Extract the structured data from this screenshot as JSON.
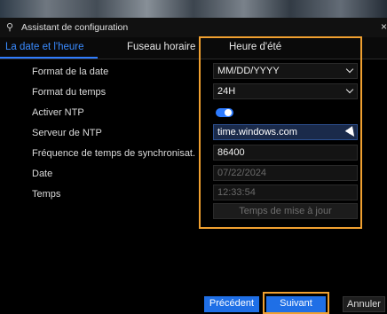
{
  "window": {
    "title": "Assistant de configuration",
    "close_glyph": "×"
  },
  "tabs": [
    {
      "label": "La date et l'heure",
      "active": true
    },
    {
      "label": "Fuseau horaire",
      "active": false
    },
    {
      "label": "Heure d'été",
      "active": false
    }
  ],
  "form": {
    "date_format": {
      "label": "Format de la date",
      "value": "MM/DD/YYYY"
    },
    "time_format": {
      "label": "Format du temps",
      "value": "24H"
    },
    "ntp_enable": {
      "label": "Activer NTP",
      "enabled": true
    },
    "ntp_server": {
      "label": "Serveur de NTP",
      "value": "time.windows.com"
    },
    "sync_frequency": {
      "label": "Fréquence de temps de synchronisat.",
      "value": "86400"
    },
    "date": {
      "label": "Date",
      "value": "07/22/2024"
    },
    "time": {
      "label": "Temps",
      "value": "12:33:54"
    },
    "update_button": "Temps de mise à jour"
  },
  "footer": {
    "previous": "Précédent",
    "next": "Suivant",
    "cancel": "Annuler"
  },
  "colors": {
    "accent": "#2f7dff",
    "highlight": "#f0a030"
  }
}
